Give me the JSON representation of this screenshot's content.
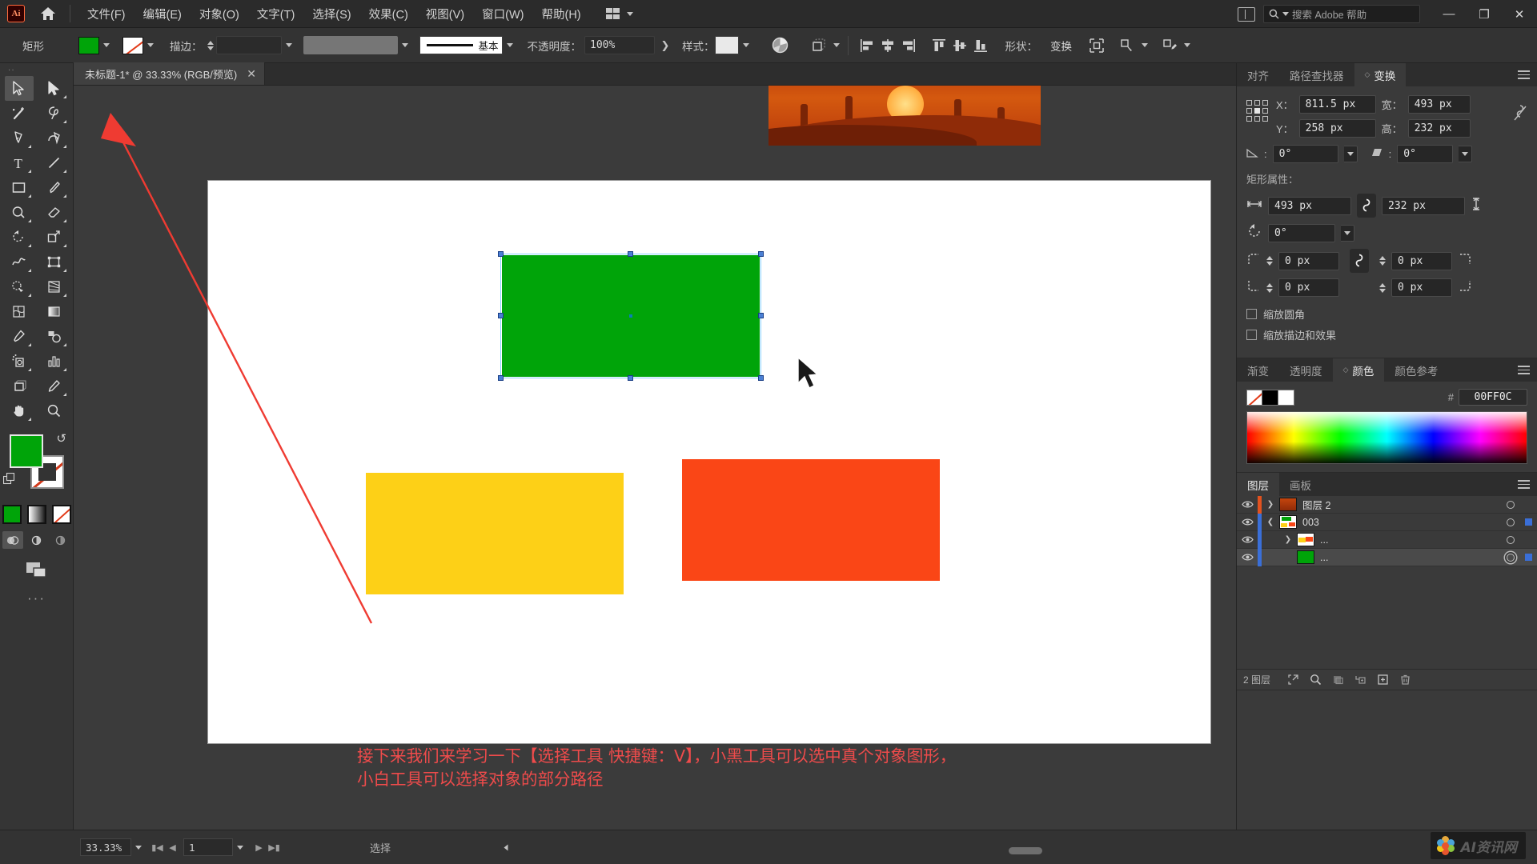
{
  "app": {
    "logo_text": "Ai",
    "home_icon": "home-icon",
    "search_placeholder": "搜索 Adobe 帮助",
    "arrange_label": "arrange-documents"
  },
  "menu": {
    "items": [
      {
        "label": "文件(F)"
      },
      {
        "label": "编辑(E)"
      },
      {
        "label": "对象(O)"
      },
      {
        "label": "文字(T)"
      },
      {
        "label": "选择(S)"
      },
      {
        "label": "效果(C)"
      },
      {
        "label": "视图(V)"
      },
      {
        "label": "窗口(W)"
      },
      {
        "label": "帮助(H)"
      }
    ]
  },
  "window_buttons": {
    "minimize": "—",
    "restore": "❐",
    "close": "✕"
  },
  "control_bar": {
    "object_label": "矩形",
    "fill_color": "#00a409",
    "stroke_label": "描边：",
    "stroke_weight": "",
    "stroke_profile_label": "基本",
    "opacity_label": "不透明度：",
    "opacity_value": "100%",
    "style_label": "样式：",
    "shape_label": "形状：",
    "transform_label": "变换",
    "icons": [
      "recolor-artwork-icon",
      "transform-shape-icon",
      "align-left-icon",
      "align-center-horizontal-icon",
      "align-right-icon",
      "align-top-icon",
      "align-center-vertical-icon",
      "align-bottom-icon",
      "isolate-icon",
      "select-similar-icon",
      "edit-toolbar-icon"
    ]
  },
  "toolbar": {
    "tools": [
      {
        "name": "selection-tool",
        "selected": true
      },
      {
        "name": "direct-selection-tool",
        "selected": false
      },
      {
        "name": "magic-wand-tool",
        "selected": false
      },
      {
        "name": "lasso-tool",
        "selected": false
      },
      {
        "name": "pen-tool",
        "selected": false
      },
      {
        "name": "curvature-tool",
        "selected": false
      },
      {
        "name": "type-tool",
        "selected": false
      },
      {
        "name": "line-segment-tool",
        "selected": false
      },
      {
        "name": "rectangle-tool",
        "selected": false
      },
      {
        "name": "paintbrush-tool",
        "selected": false
      },
      {
        "name": "shaper-tool",
        "selected": false
      },
      {
        "name": "eraser-tool",
        "selected": false
      },
      {
        "name": "rotate-tool",
        "selected": false
      },
      {
        "name": "scale-tool",
        "selected": false
      },
      {
        "name": "width-tool",
        "selected": false
      },
      {
        "name": "free-transform-tool",
        "selected": false
      },
      {
        "name": "shape-builder-tool",
        "selected": false
      },
      {
        "name": "perspective-grid-tool",
        "selected": false
      },
      {
        "name": "mesh-tool",
        "selected": false
      },
      {
        "name": "gradient-tool",
        "selected": false
      },
      {
        "name": "eyedropper-tool",
        "selected": false
      },
      {
        "name": "blend-tool",
        "selected": false
      },
      {
        "name": "symbol-sprayer-tool",
        "selected": false
      },
      {
        "name": "column-graph-tool",
        "selected": false
      },
      {
        "name": "artboard-tool",
        "selected": false
      },
      {
        "name": "slice-tool",
        "selected": false
      },
      {
        "name": "hand-tool",
        "selected": false
      },
      {
        "name": "zoom-tool",
        "selected": false
      }
    ],
    "fill_color": "#00a409",
    "stroke_color": "none",
    "mini_swatches": [
      "#00a409",
      "gradient",
      "none"
    ],
    "draw_modes": [
      "draw-normal",
      "draw-behind",
      "draw-inside"
    ],
    "screen_mode": "change-screen-mode",
    "more_label": "···"
  },
  "document_tab": {
    "title": "未标题-1* @ 33.33% (RGB/预览)",
    "close": "✕"
  },
  "canvas": {
    "annotation_line1": "接下来我们来学习一下【选择工具 快捷键：V】，小黑工具可以选中真个对象图形，",
    "annotation_line2": "小白工具可以选择对象的部分路径",
    "annotation_color": "#ef4b4b",
    "shapes": [
      {
        "name": "green-rectangle",
        "color": "#00a409",
        "selected": true
      },
      {
        "name": "yellow-rectangle",
        "color": "#fdd017",
        "selected": false
      },
      {
        "name": "orange-rectangle",
        "color": "#fa4616",
        "selected": false
      }
    ]
  },
  "transform_panel": {
    "tabs": [
      {
        "label": "对齐",
        "active": false
      },
      {
        "label": "路径查找器",
        "active": false
      },
      {
        "label": "变换",
        "active": true
      }
    ],
    "x_label": "X：",
    "x_value": "811.5 px",
    "y_label": "Y：",
    "y_value": "258 px",
    "w_label": "宽：",
    "w_value": "493 px",
    "h_label": "高：",
    "h_value": "232 px",
    "shear_angle": "0°",
    "rotate_angle": "0°",
    "rect_section_title": "矩形属性：",
    "rect_width": "493 px",
    "rect_height": "232 px",
    "rect_rotation": "0°",
    "corner_tl": "0 px",
    "corner_tr": "0 px",
    "corner_bl": "0 px",
    "corner_br": "0 px",
    "checkbox_scale_corners": "缩放圆角",
    "checkbox_scale_strokes": "缩放描边和效果"
  },
  "color_panel": {
    "tabs": [
      {
        "label": "渐变",
        "active": false
      },
      {
        "label": "透明度",
        "active": false
      },
      {
        "label": "颜色",
        "active": true
      },
      {
        "label": "颜色参考",
        "active": false
      }
    ],
    "hex_symbol": "#",
    "hex_value": "00FF0C"
  },
  "layers_panel": {
    "tabs": [
      {
        "label": "图层",
        "active": true
      },
      {
        "label": "画板",
        "active": false
      }
    ],
    "rows": [
      {
        "name": "图层 2",
        "color": "#e2521f",
        "expanded": false,
        "indent": 0,
        "selected": false,
        "targeted": false,
        "thumb": "desert"
      },
      {
        "name": "003",
        "color": "#3a6fd8",
        "expanded": true,
        "indent": 0,
        "selected": false,
        "targeted": true,
        "thumb": "group"
      },
      {
        "name": "...",
        "color": "#3a6fd8",
        "expanded": false,
        "indent": 1,
        "selected": false,
        "targeted": false,
        "thumb": "sub1"
      },
      {
        "name": "...",
        "color": "#3a6fd8",
        "expanded": null,
        "indent": 1,
        "selected": true,
        "targeted": true,
        "thumb": "green"
      }
    ],
    "footer_count": "2 图层",
    "footer_icons": [
      "locate-object-icon",
      "search-icon",
      "make-clipping-mask-icon",
      "create-sublayer-icon",
      "create-new-layer-icon",
      "delete-selection-icon"
    ]
  },
  "status_bar": {
    "zoom_value": "33.33%",
    "page_value": "1",
    "status_text": "选择",
    "first_icon": "first-page-icon",
    "prev_icon": "previous-page-icon",
    "next_icon": "next-page-icon",
    "last_icon": "last-page-icon"
  },
  "watermark": {
    "text": "AI资讯网"
  }
}
